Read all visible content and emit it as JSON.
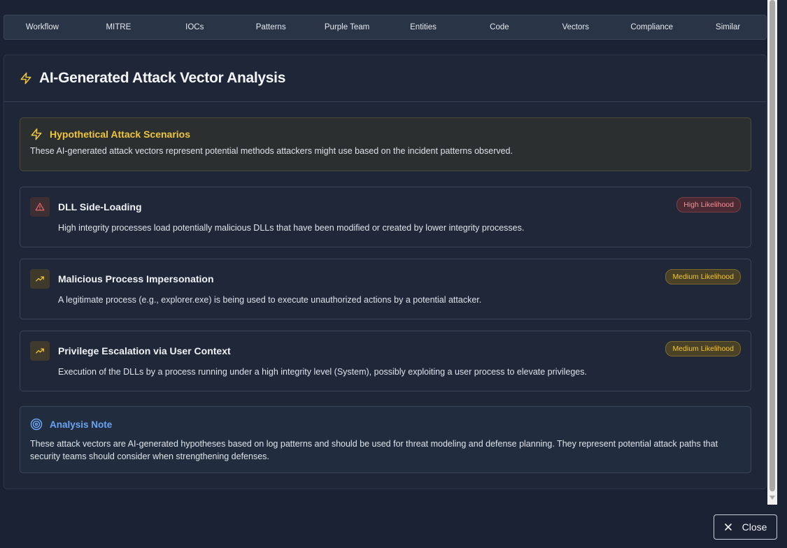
{
  "tabs": [
    {
      "label": "Workflow"
    },
    {
      "label": "MITRE"
    },
    {
      "label": "IOCs"
    },
    {
      "label": "Patterns"
    },
    {
      "label": "Purple Team"
    },
    {
      "label": "Entities"
    },
    {
      "label": "Code"
    },
    {
      "label": "Vectors"
    },
    {
      "label": "Compliance"
    },
    {
      "label": "Similar"
    }
  ],
  "panel": {
    "title": "AI-Generated Attack Vector Analysis",
    "icon": "lightning-icon"
  },
  "hypothetical": {
    "title": "Hypothetical Attack Scenarios",
    "text": "These AI-generated attack vectors represent potential methods attackers might use based on the incident patterns observed."
  },
  "vectors": [
    {
      "title": "DLL Side-Loading",
      "description": "High integrity processes load potentially malicious DLLs that have been modified or created by lower integrity processes.",
      "likelihood": "High Likelihood",
      "icon": "alert-triangle-icon"
    },
    {
      "title": "Malicious Process Impersonation",
      "description": "A legitimate process (e.g., explorer.exe) is being used to execute unauthorized actions by a potential attacker.",
      "likelihood": "Medium Likelihood",
      "icon": "trending-up-icon"
    },
    {
      "title": "Privilege Escalation via User Context",
      "description": "Execution of the DLLs by a process running under a high integrity level (System), possibly exploiting a user process to elevate privileges.",
      "likelihood": "Medium Likelihood",
      "icon": "trending-up-icon"
    }
  ],
  "note": {
    "title": "Analysis Note",
    "text": "These attack vectors are AI-generated hypotheses based on log patterns and should be used for threat modeling and defense planning. They represent potential attack paths that security teams should consider when strengthening defenses."
  },
  "close_label": "Close",
  "colors": {
    "accent_yellow": "#f0c53a",
    "accent_blue": "#6aa4f2",
    "danger": "#f0919b"
  }
}
